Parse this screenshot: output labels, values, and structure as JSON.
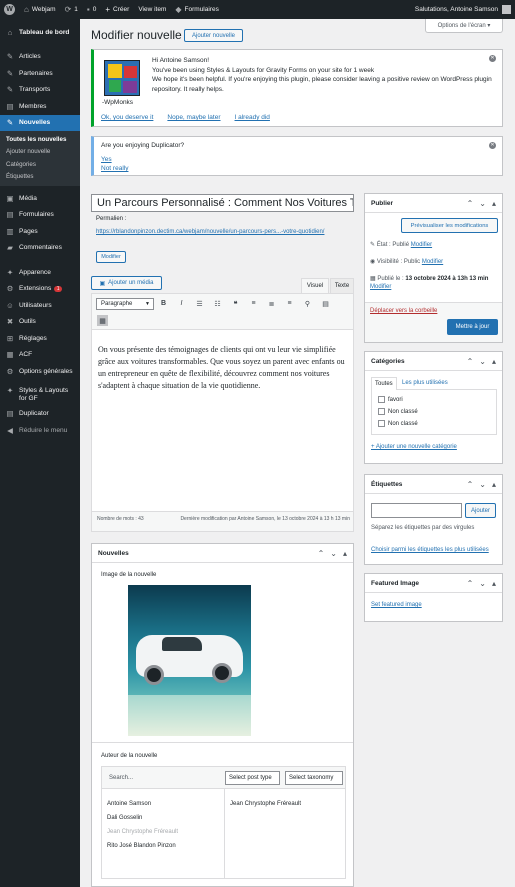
{
  "admin_bar": {
    "wp_logo": "W",
    "site": "Webjam",
    "updates": "1",
    "comments": "0",
    "new": "Créer",
    "view": "View item",
    "forms": "Formulaires",
    "greeting": "Salutations, Antoine Samson"
  },
  "sidebar": {
    "items": [
      {
        "icon": "⌂",
        "label": "Tableau de bord"
      },
      {
        "icon": "✎",
        "label": "Articles"
      },
      {
        "icon": "✎",
        "label": "Partenaires"
      },
      {
        "icon": "✎",
        "label": "Transports"
      },
      {
        "icon": "▤",
        "label": "Membres"
      },
      {
        "icon": "✎",
        "label": "Nouvelles"
      },
      {
        "icon": "▣",
        "label": "Média"
      },
      {
        "icon": "▤",
        "label": "Formulaires"
      },
      {
        "icon": "▥",
        "label": "Pages"
      },
      {
        "icon": "▰",
        "label": "Commentaires"
      },
      {
        "icon": "✦",
        "label": "Apparence"
      },
      {
        "icon": "⚙",
        "label": "Extensions",
        "badge": "1"
      },
      {
        "icon": "☺",
        "label": "Utilisateurs"
      },
      {
        "icon": "✖",
        "label": "Outils"
      },
      {
        "icon": "⊞",
        "label": "Réglages"
      },
      {
        "icon": "▦",
        "label": "ACF"
      },
      {
        "icon": "⚙",
        "label": "Options générales"
      },
      {
        "icon": "✦",
        "label": "Styles & Layouts for GF"
      },
      {
        "icon": "▤",
        "label": "Duplicator"
      },
      {
        "icon": "◀",
        "label": "Réduire le menu"
      }
    ],
    "submenu": [
      "Toutes les nouvelles",
      "Ajouter nouvelle",
      "Catégories",
      "Étiquettes"
    ]
  },
  "page": {
    "title": "Modifier nouvelle",
    "add_new": "Ajouter nouvelle",
    "screen_options": "Options de l'écran ▾"
  },
  "notice1": {
    "greeting": "Hi Antoine Samson!",
    "line1": "You've been using Styles & Layouts for Gravity Forms on your site for 1 week",
    "line2": "We hope it's been helpful. If you're enjoying this plugin, please consider leaving a positive review on WordPress plugin repository. It really helps.",
    "brand": "-WpMonks",
    "link1": "Ok, you deserve it",
    "link2": "Nope, maybe later",
    "link3": "I already did"
  },
  "notice2": {
    "question": "Are you enjoying Duplicator?",
    "yes": "Yes",
    "no": "Not really"
  },
  "post": {
    "title": "Un Parcours Personnalisé : Comment Nos Voitures Transformables",
    "permalink_label": "Permalien :",
    "permalink_url": "https://rblandonpinzon.dectim.ca/webjam/nouvelle/un-parcours-pers...-votre-quotidien/",
    "modify": "Modifier",
    "add_media": "Ajouter un média",
    "tab_visual": "Visuel",
    "tab_text": "Texte",
    "format": "Paragraphe",
    "content": "On vous présente des témoignages de clients qui ont vu leur vie simplifiée grâce aux voitures transformables. Que vous soyez un parent avec enfants ou un entrepreneur en quête de flexibilité, découvrez comment nos voitures s'adaptent à chaque situation de la vie quotidienne.",
    "word_count": "Nombre de mots : 43",
    "last_edit": "Dernière modification par Antoine Samson, le 13 octobre 2024 à 13 h 13 min"
  },
  "publish": {
    "title": "Publier",
    "preview": "Prévisualiser les modifications",
    "status_label": "État : Publié",
    "status_link": "Modifier",
    "visibility_label": "Visibilité : Public",
    "visibility_link": "Modifier",
    "published_prefix": "Publié le :",
    "published_date": "13 octobre 2024 à 13h 13 min",
    "published_link": "Modifier",
    "trash": "Déplacer vers la corbeille",
    "update": "Mettre à jour"
  },
  "categories": {
    "title": "Catégories",
    "tab_all": "Toutes",
    "tab_popular": "Les plus utilisées",
    "items": [
      "favori",
      "Non classé",
      "Non classé"
    ],
    "add": "+ Ajouter une nouvelle catégorie"
  },
  "tags": {
    "title": "Étiquettes",
    "add": "Ajouter",
    "hint": "Séparez les étiquettes par des virgules",
    "choose": "Choisir parmi les étiquettes les plus utilisées"
  },
  "featured": {
    "title": "Featured Image",
    "set": "Set featured image"
  },
  "nouvelles_box": {
    "title": "Nouvelles",
    "image_label": "Image de la nouvelle",
    "author_label": "Auteur de la nouvelle",
    "search_placeholder": "Search...",
    "select_post_type": "Select post type",
    "select_taxonomy": "Select taxonomy",
    "authors": [
      "Antoine Samson",
      "Dali Gosselin",
      "Jean Chrystophe Fréreault",
      "Rito José Blandon Pinzon"
    ],
    "selected": [
      "Jean Chrystophe Fréreault"
    ]
  }
}
